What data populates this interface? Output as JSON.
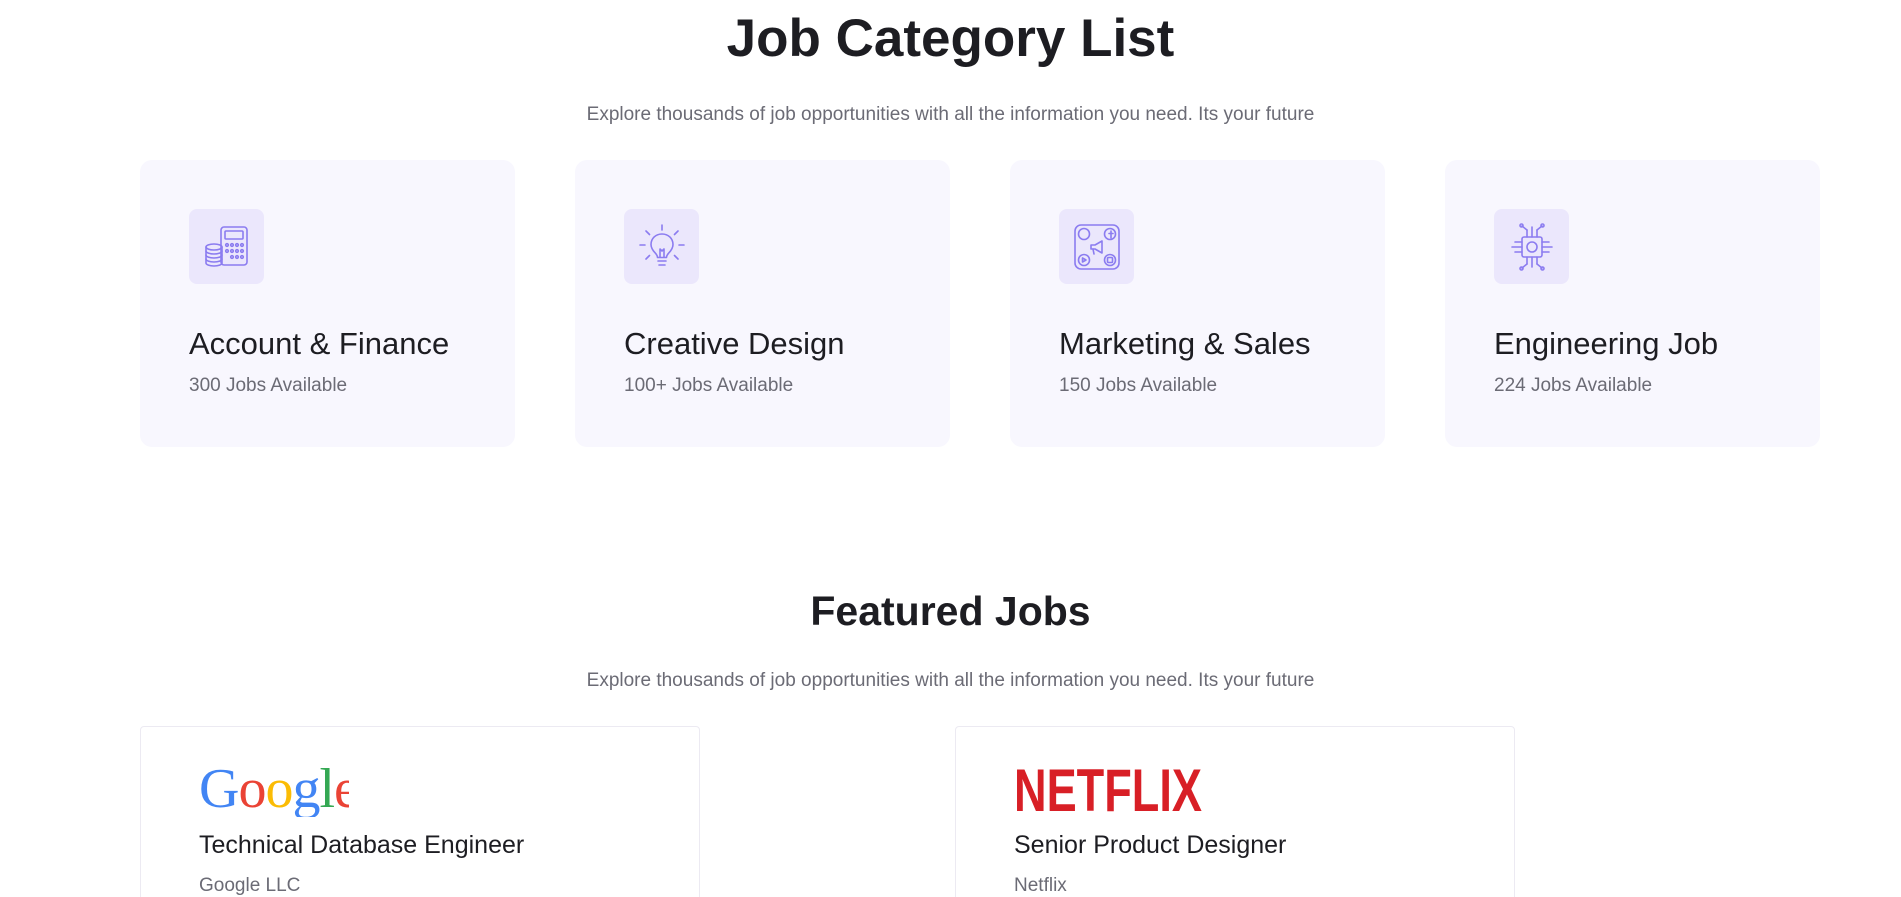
{
  "job_categories": {
    "title": "Job Category List",
    "subtitle": "Explore thousands of job opportunities with all the information you need. Its your future",
    "items": [
      {
        "name": "Account & Finance",
        "count": "300 Jobs Available",
        "icon": "calculator-coins-icon"
      },
      {
        "name": "Creative Design",
        "count": "100+ Jobs Available",
        "icon": "lightbulb-icon"
      },
      {
        "name": "Marketing & Sales",
        "count": "150 Jobs Available",
        "icon": "social-media-megaphone-icon"
      },
      {
        "name": "Engineering Job",
        "count": "224 Jobs Available",
        "icon": "circuit-chip-icon"
      }
    ]
  },
  "featured_jobs": {
    "title": "Featured Jobs",
    "subtitle": "Explore thousands of job opportunities with all the information you need. Its your future",
    "items": [
      {
        "logo_text": "Google",
        "title": "Technical Database Engineer",
        "company": "Google LLC"
      },
      {
        "logo_text": "NETFLIX",
        "title": "Senior Product Designer",
        "company": "Netflix"
      }
    ]
  },
  "colors": {
    "icon_stroke": "#8b7cf0",
    "card_background": "#f8f7fe",
    "icon_background": "#ebe7fc",
    "netflix_red": "#d81f26",
    "google_blue": "#4285f4",
    "google_red": "#ea4335",
    "google_yellow": "#fbbc05",
    "google_green": "#34a853"
  }
}
